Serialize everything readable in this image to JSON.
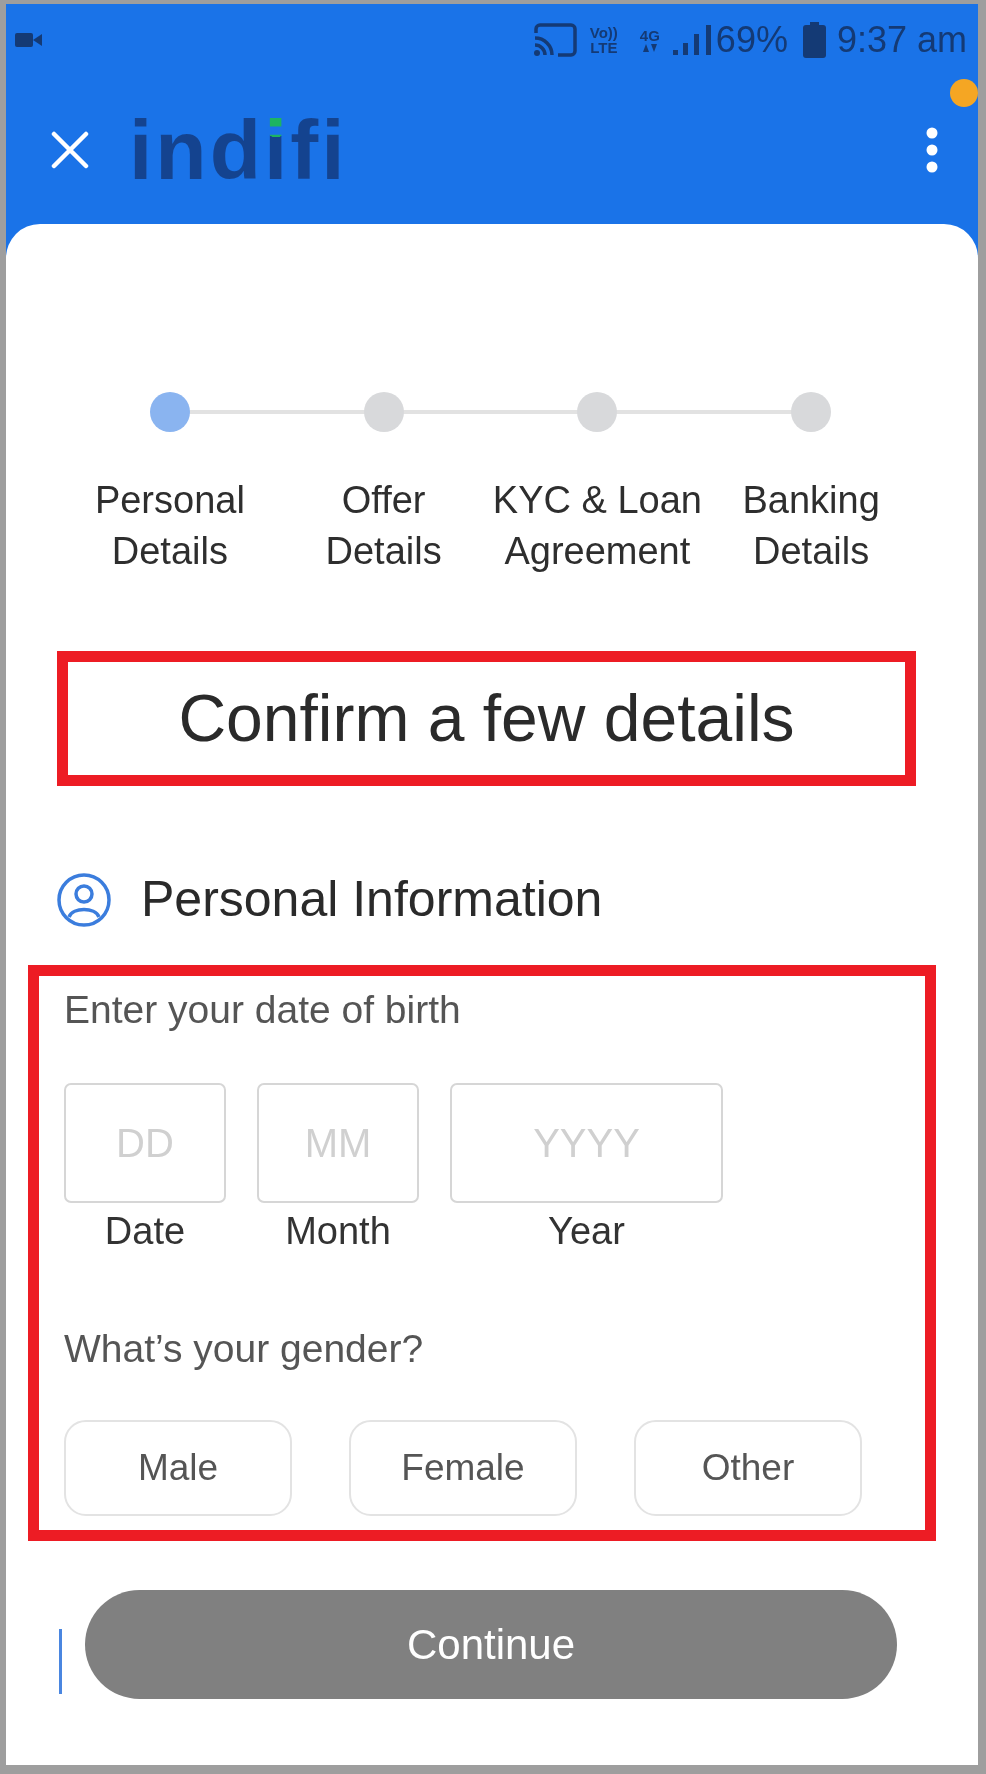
{
  "status_bar": {
    "volte_top": "Vo))",
    "volte_bottom": "LTE",
    "network": "4G",
    "battery": "69%",
    "time": "9:37 am"
  },
  "app_bar": {
    "logo": "indifi"
  },
  "stepper": {
    "steps": [
      {
        "label": "Personal\nDetails",
        "selected": true
      },
      {
        "label": "Offer\nDetails",
        "selected": false
      },
      {
        "label": "KYC & Loan\nAgreement",
        "selected": false
      },
      {
        "label": "Banking\nDetails",
        "selected": false
      }
    ]
  },
  "title": {
    "text": "Confirm a few details",
    "highlighted": true
  },
  "section": {
    "title": "Personal Information"
  },
  "form": {
    "highlighted": true,
    "dob": {
      "label": "Enter your date of birth",
      "fields": [
        {
          "placeholder": "DD",
          "caption": "Date"
        },
        {
          "placeholder": "MM",
          "caption": "Month"
        },
        {
          "placeholder": "YYYY",
          "caption": "Year"
        }
      ]
    },
    "gender": {
      "label": "What’s your gender?",
      "options": [
        {
          "label": "Male",
          "selected": false
        },
        {
          "label": "Female",
          "selected": false
        },
        {
          "label": "Other",
          "selected": false
        }
      ]
    }
  },
  "continue_button": {
    "label": "Continue",
    "disabled": true
  }
}
